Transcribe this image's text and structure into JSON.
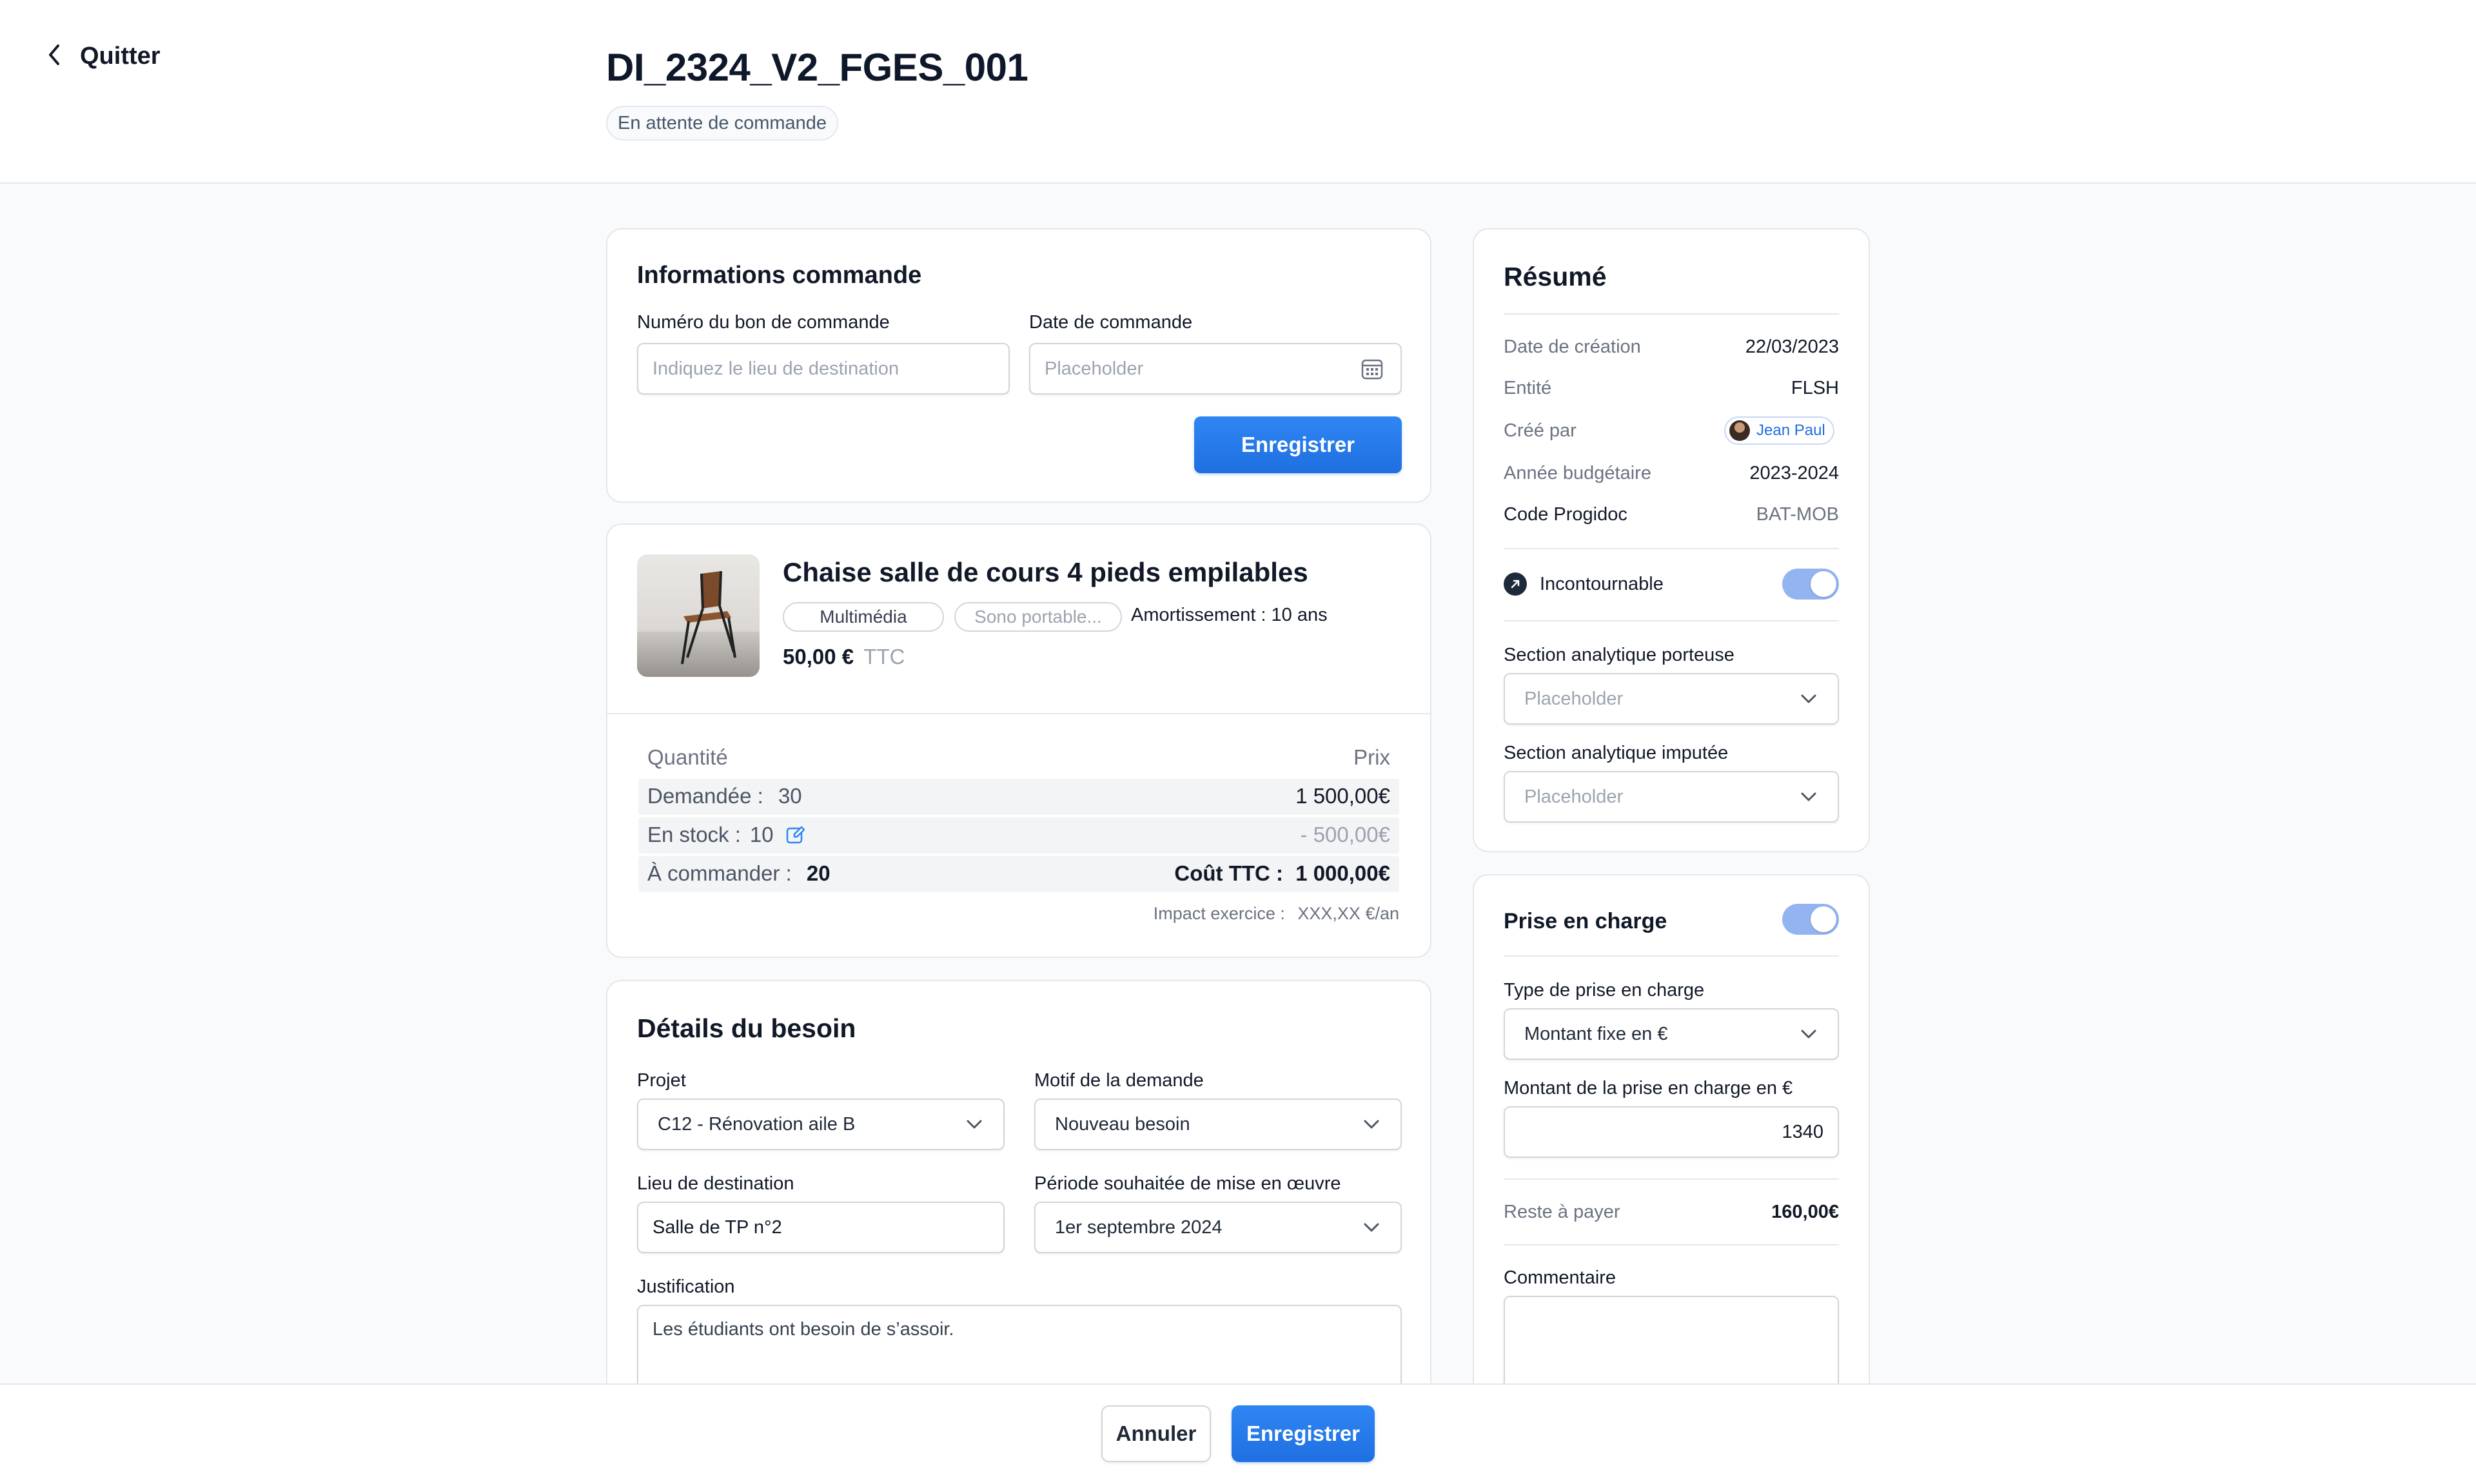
{
  "header": {
    "quit_label": "Quitter",
    "title": "DI_2324_V2_FGES_001",
    "status": "En attente de commande"
  },
  "order_info": {
    "title": "Informations commande",
    "po_number_label": "Numéro du bon de commande",
    "po_number_placeholder": "Indiquez le lieu de destination",
    "order_date_label": "Date de commande",
    "order_date_placeholder": "Placeholder",
    "save_label": "Enregistrer"
  },
  "product": {
    "name": "Chaise salle de cours 4 pieds empilables",
    "tags": [
      "Multimédia",
      "Sono portable..."
    ],
    "amortization": "Amortissement : 10 ans",
    "price": "50,00 €",
    "price_suffix": "TTC",
    "qty_header": "Quantité",
    "price_header": "Prix",
    "requested_label": "Demandée :",
    "requested_qty": "30",
    "requested_price": "1 500,00€",
    "stock_label": "En stock :",
    "stock_qty": "10",
    "stock_price": "- 500,00€",
    "to_order_label": "À commander :",
    "to_order_qty": "20",
    "cost_label": "Coût TTC :",
    "cost_value": "1 000,00€",
    "impact_label": "Impact exercice :",
    "impact_value": "XXX,XX €/an"
  },
  "need_details": {
    "title": "Détails du besoin",
    "project_label": "Projet",
    "project_value": "C12 - Rénovation aile B",
    "reason_label": "Motif de la demande",
    "reason_value": "Nouveau besoin",
    "destination_label": "Lieu de destination",
    "destination_value": "Salle de TP n°2",
    "period_label": "Période souhaitée de mise en œuvre",
    "period_value": "1er septembre 2024",
    "justification_label": "Justification",
    "justification_value": "Les étudiants ont besoin de s’assoir."
  },
  "summary": {
    "title": "Résumé",
    "creation_date_label": "Date de création",
    "creation_date": "22/03/2023",
    "entity_label": "Entité",
    "entity": "FLSH",
    "created_by_label": "Créé par",
    "created_by": "Jean Paul",
    "budget_year_label": "Année budgétaire",
    "budget_year": "2023-2024",
    "progidoc_label": "Code Progidoc",
    "progidoc": "BAT-MOB",
    "mandatory_label": "Incontournable",
    "mandatory_on": true,
    "section_carrier_label": "Section analytique porteuse",
    "section_carrier_placeholder": "Placeholder",
    "section_charged_label": "Section analytique imputée",
    "section_charged_placeholder": "Placeholder"
  },
  "coverage": {
    "title": "Prise en charge",
    "enabled": true,
    "type_label": "Type de prise en charge",
    "type_value": "Montant fixe en €",
    "amount_label": "Montant de la prise en charge en €",
    "amount_value": "1340",
    "remaining_label": "Reste à payer",
    "remaining_value": "160,00€",
    "comment_label": "Commentaire",
    "comment_value": ""
  },
  "footer": {
    "cancel_label": "Annuler",
    "save_label": "Enregistrer"
  },
  "colors": {
    "primary": "#1f6fe0",
    "toggle_on": "#93b4f0",
    "background": "#f8fafc"
  }
}
